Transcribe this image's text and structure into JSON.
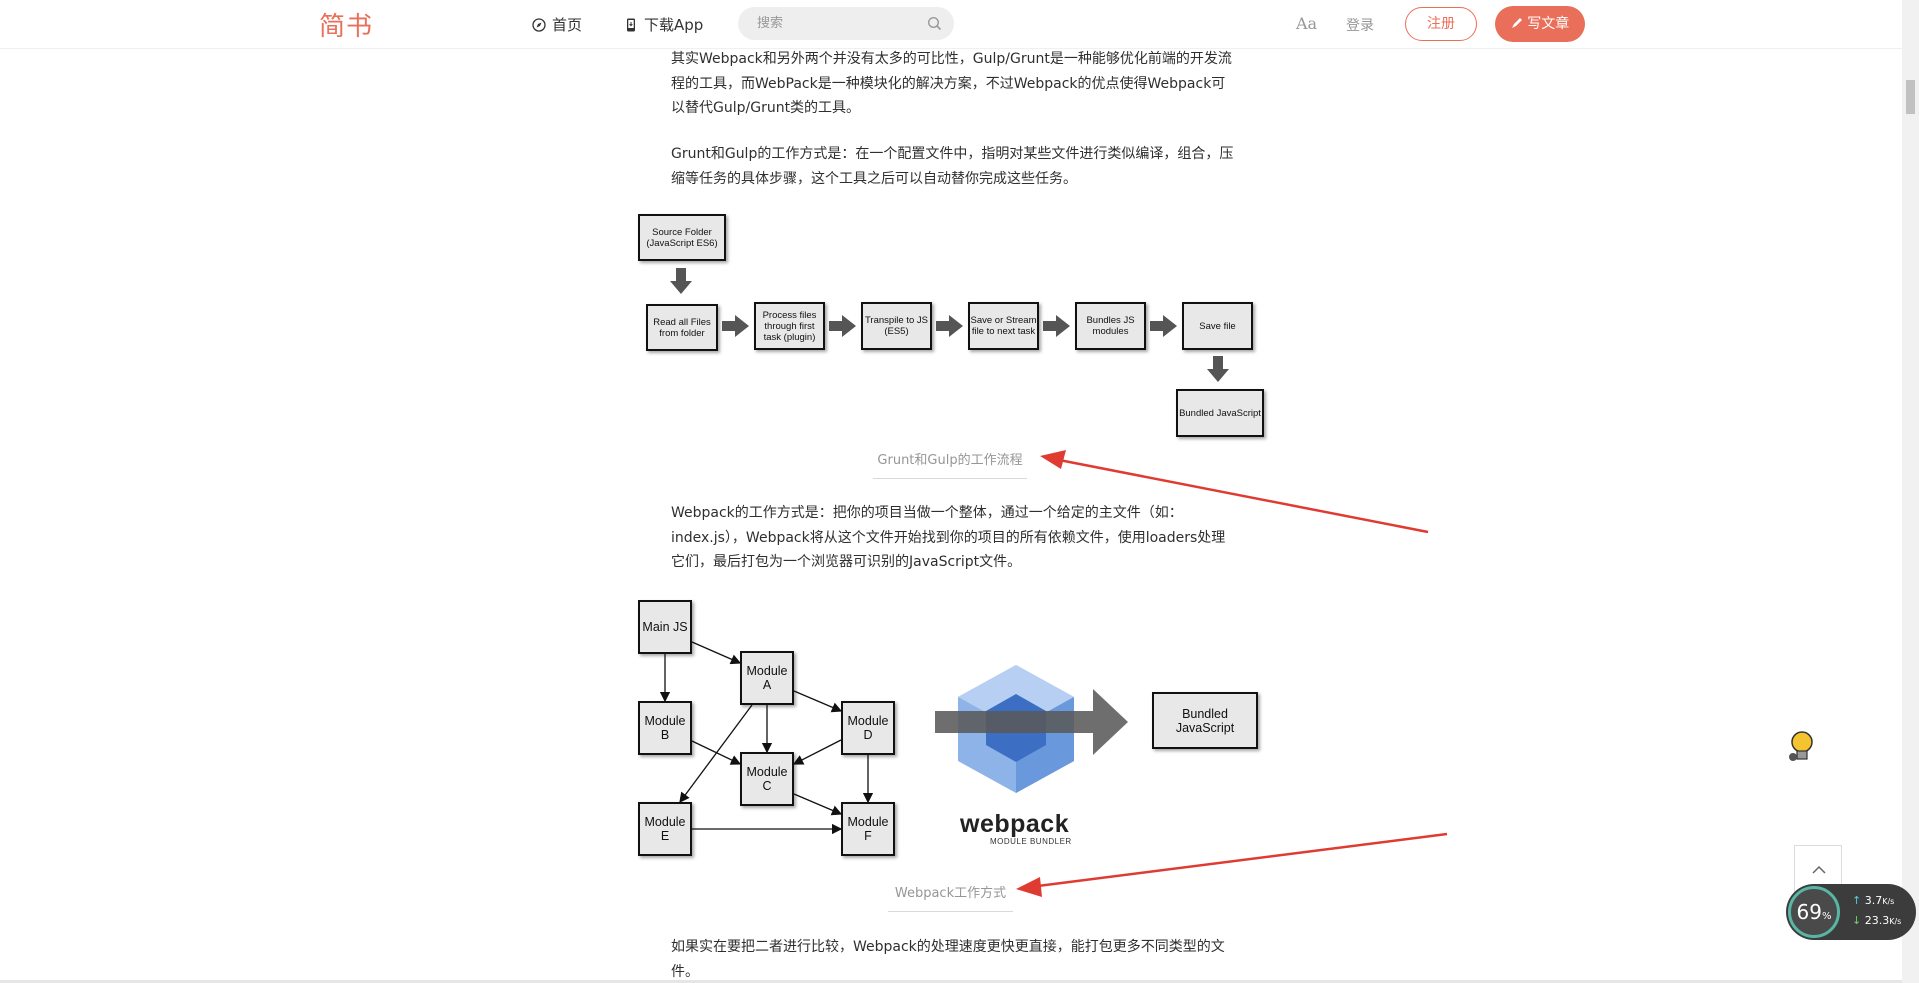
{
  "header": {
    "logo": "简书",
    "nav_home": "首页",
    "nav_app": "下载App",
    "search_placeholder": "搜索",
    "aa": "Aa",
    "login": "登录",
    "register": "注册",
    "write": "写文章",
    "accent_color": "#ea6f5a"
  },
  "article": {
    "p1": "其实Webpack和另外两个并没有太多的可比性，Gulp/Grunt是一种能够优化前端的开发流程的工具，而WebPack是一种模块化的解决方案，不过Webpack的优点使得Webpack可以替代Gulp/Grunt类的工具。",
    "p2": "Grunt和Gulp的工作方式是：在一个配置文件中，指明对某些文件进行类似编译，组合，压缩等任务的具体步骤，这个工具之后可以自动替你完成这些任务。",
    "caption1": "Grunt和Gulp的工作流程",
    "p3": "Webpack的工作方式是：把你的项目当做一个整体，通过一个给定的主文件（如：index.js），Webpack将从这个文件开始找到你的项目的所有依赖文件，使用loaders处理它们，最后打包为一个浏览器可识别的JavaScript文件。",
    "caption2": "Webpack工作方式",
    "p4": "如果实在要把二者进行比较，Webpack的处理速度更快更直接，能打包更多不同类型的文件。"
  },
  "diagram1": {
    "source": "Source Folder (JavaScript ES6)",
    "steps": [
      "Read all Files from folder",
      "Process files through first task (plugin)",
      "Transpile to JS (ES5)",
      "Save or Stream file to next task",
      "Bundles JS modules",
      "Save file"
    ],
    "output": "Bundled JavaScript"
  },
  "diagram2": {
    "main": "Main JS",
    "modules": [
      "Module A",
      "Module B",
      "Module C",
      "Module D",
      "Module E",
      "Module F"
    ],
    "brand": "webpack",
    "brand_sub": "MODULE BUNDLER",
    "output": "Bundled JavaScript"
  },
  "widgets": {
    "net_percent": "69",
    "net_percent_unit": "%",
    "upload": "3.7",
    "upload_unit": "K/s",
    "download": "23.3",
    "download_unit": "K/s"
  }
}
